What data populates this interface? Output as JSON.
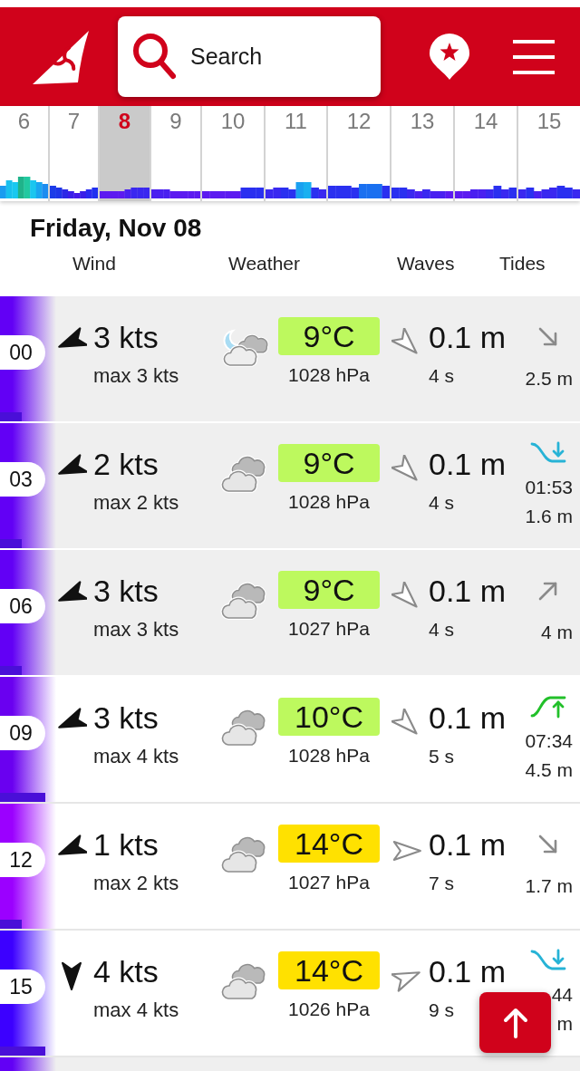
{
  "header": {
    "search": {
      "placeholder": "Search"
    }
  },
  "days": [
    {
      "label": "6",
      "selected": false
    },
    {
      "label": "7",
      "selected": false
    },
    {
      "label": "8",
      "selected": true
    },
    {
      "label": "9",
      "selected": false
    },
    {
      "label": "10",
      "selected": false
    },
    {
      "label": "11",
      "selected": false
    },
    {
      "label": "12",
      "selected": false
    },
    {
      "label": "13",
      "selected": false
    },
    {
      "label": "14",
      "selected": false
    },
    {
      "label": "15",
      "selected": false
    }
  ],
  "date_title": "Friday, Nov 08",
  "columns": [
    "Wind",
    "Weather",
    "Waves",
    "Tides"
  ],
  "rows": [
    {
      "hour": "00",
      "shaded": true,
      "wind_strip": {
        "color": "#6200f5",
        "level": 0.38
      },
      "wind_arrow": {
        "kind": "westsouthwest"
      },
      "wind_speed": "3 kts",
      "wind_max": "max 3 kts",
      "weather": {
        "kind": "night"
      },
      "temperature": {
        "label": "9°C",
        "color": "#bdf95e"
      },
      "pressure": "1028 hPa",
      "wave_arrow": {
        "kind": "southeast"
      },
      "wave_height": "0.1 m",
      "wave_period": "4 s",
      "tide": {
        "kind": "falling",
        "height": "2.5 m"
      }
    },
    {
      "hour": "03",
      "shaded": true,
      "wind_strip": {
        "color": "#6200f5",
        "level": 0.38
      },
      "wind_arrow": {
        "kind": "westsouthwest"
      },
      "wind_speed": "2 kts",
      "wind_max": "max 2 kts",
      "weather": {
        "kind": "cloudy"
      },
      "temperature": {
        "label": "9°C",
        "color": "#bdf95e"
      },
      "pressure": "1028 hPa",
      "wave_arrow": {
        "kind": "southeast"
      },
      "wave_height": "0.1 m",
      "wave_period": "4 s",
      "tide": {
        "kind": "low",
        "time": "01:53",
        "height": "1.6 m"
      }
    },
    {
      "hour": "06",
      "shaded": true,
      "wind_strip": {
        "color": "#6200f5",
        "level": 0.38
      },
      "wind_arrow": {
        "kind": "westsouthwest"
      },
      "wind_speed": "3 kts",
      "wind_max": "max 3 kts",
      "weather": {
        "kind": "cloudy"
      },
      "temperature": {
        "label": "9°C",
        "color": "#bdf95e"
      },
      "pressure": "1027 hPa",
      "wave_arrow": {
        "kind": "southeast"
      },
      "wave_height": "0.1 m",
      "wave_period": "4 s",
      "tide": {
        "kind": "rising",
        "height": "4 m"
      }
    },
    {
      "hour": "09",
      "shaded": false,
      "wind_strip": {
        "color": "#6a00f0",
        "level": 0.8
      },
      "wind_arrow": {
        "kind": "westsouthwest"
      },
      "wind_speed": "3 kts",
      "wind_max": "max 4 kts",
      "weather": {
        "kind": "cloudy"
      },
      "temperature": {
        "label": "10°C",
        "color": "#bdf95e"
      },
      "pressure": "1028 hPa",
      "wave_arrow": {
        "kind": "southeast"
      },
      "wave_height": "0.1 m",
      "wave_period": "5 s",
      "tide": {
        "kind": "high",
        "time": "07:34",
        "height": "4.5 m"
      }
    },
    {
      "hour": "12",
      "shaded": false,
      "wind_strip": {
        "color": "#9b00ff",
        "level": 0.38
      },
      "wind_arrow": {
        "kind": "westsouthwest"
      },
      "wind_speed": "1 kts",
      "wind_max": "max 2 kts",
      "weather": {
        "kind": "cloudy"
      },
      "temperature": {
        "label": "14°C",
        "color": "#ffe100"
      },
      "pressure": "1027 hPa",
      "wave_arrow": {
        "kind": "east"
      },
      "wave_height": "0.1 m",
      "wave_period": "7 s",
      "tide": {
        "kind": "falling",
        "height": "1.7 m"
      }
    },
    {
      "hour": "15",
      "shaded": false,
      "wind_strip": {
        "color": "#3c00ff",
        "level": 0.8
      },
      "wind_arrow": {
        "kind": "south"
      },
      "wind_speed": "4 kts",
      "wind_max": "max 4 kts",
      "weather": {
        "kind": "cloudy"
      },
      "temperature": {
        "label": "14°C",
        "color": "#ffe100"
      },
      "pressure": "1026 hPa",
      "wave_arrow": {
        "kind": "eastnortheast"
      },
      "wave_height": "0.1 m",
      "wave_period": "9 s",
      "tide": {
        "kind": "low",
        "time": "44",
        "height": "m"
      }
    }
  ],
  "partial_row": {
    "shaded": true,
    "wind_strip": {
      "color": "#6200f5"
    }
  }
}
